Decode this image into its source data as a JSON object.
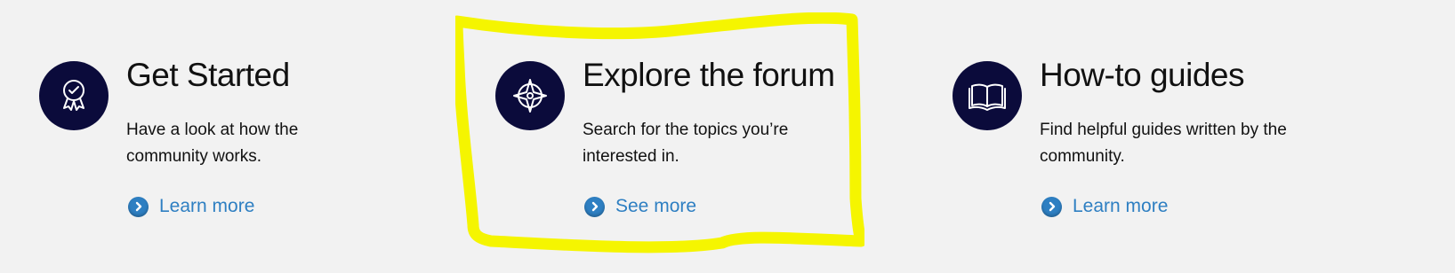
{
  "cards": [
    {
      "title": "Get Started",
      "description": "Have a look at how the community works.",
      "link_label": "Learn more",
      "icon": "award-ribbon-icon"
    },
    {
      "title": "Explore the forum",
      "description": "Search for the topics you’re interested in.",
      "link_label": "See more",
      "icon": "compass-icon"
    },
    {
      "title": "How-to guides",
      "description": "Find helpful guides written by the community.",
      "link_label": "Learn more",
      "icon": "open-book-icon"
    }
  ],
  "colors": {
    "background": "#f2f2f2",
    "icon_circle": "#0b0b3b",
    "link": "#2e7fc2",
    "highlight": "#f5f500"
  }
}
